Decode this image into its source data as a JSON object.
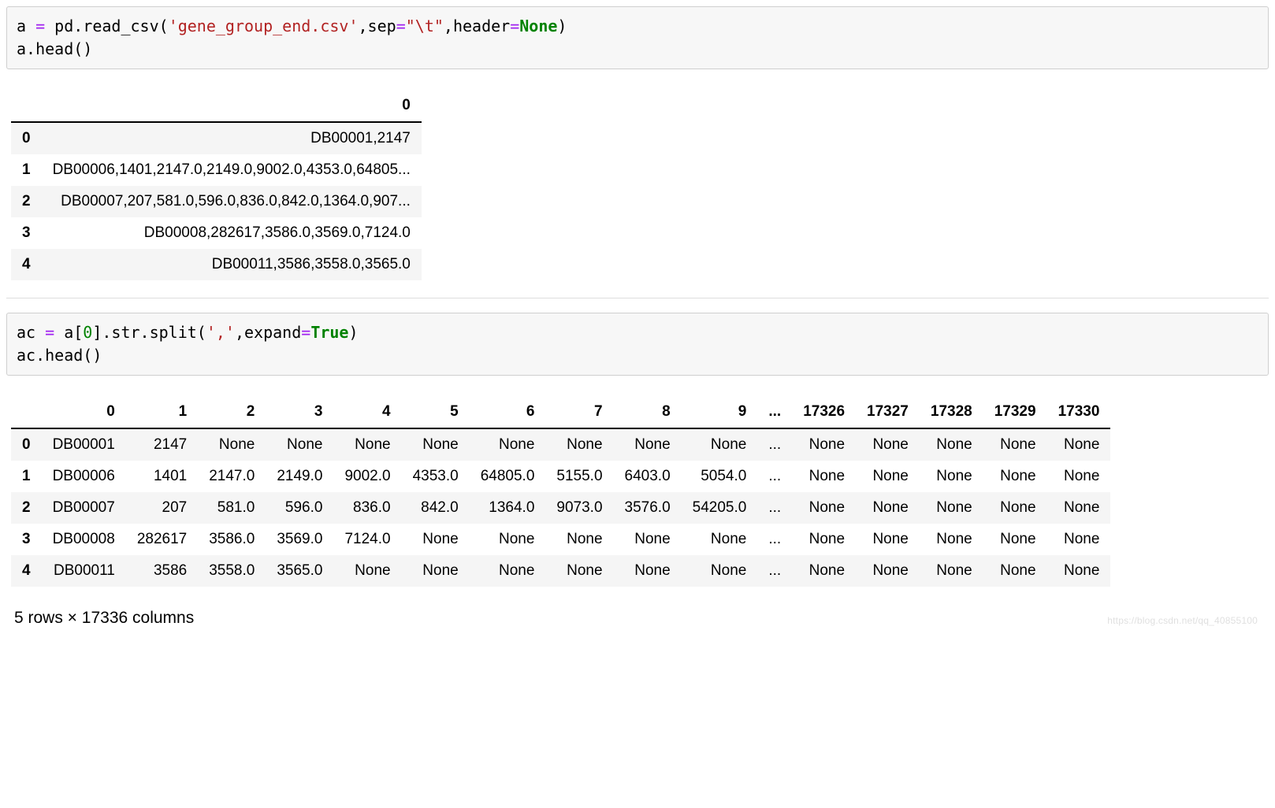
{
  "cell1": {
    "line1": {
      "prefix": "a ",
      "eq": "=",
      "fn": " pd.read_csv(",
      "arg_str": "'gene_group_end.csv'",
      "mid": ",sep",
      "eq2": "=",
      "sep_str": "\"\\t\"",
      "mid2": ",header",
      "eq3": "=",
      "none_kw": "None",
      "close": ")"
    },
    "line2": "a.head()"
  },
  "table1": {
    "columns": [
      "0"
    ],
    "rows": [
      {
        "idx": "0",
        "v": "DB00001,2147"
      },
      {
        "idx": "1",
        "v": "DB00006,1401,2147.0,2149.0,9002.0,4353.0,64805..."
      },
      {
        "idx": "2",
        "v": "DB00007,207,581.0,596.0,836.0,842.0,1364.0,907..."
      },
      {
        "idx": "3",
        "v": "DB00008,282617,3586.0,3569.0,7124.0"
      },
      {
        "idx": "4",
        "v": "DB00011,3586,3558.0,3565.0"
      }
    ]
  },
  "cell2": {
    "line1": {
      "prefix": "ac ",
      "eq": "=",
      "mid1": " a[",
      "zero": "0",
      "mid2": "].str.split(",
      "comma_str": "','",
      "mid3": ",expand",
      "eq2": "=",
      "true_kw": "True",
      "close": ")"
    },
    "line2": "ac.head()"
  },
  "table2": {
    "columns": [
      "0",
      "1",
      "2",
      "3",
      "4",
      "5",
      "6",
      "7",
      "8",
      "9",
      "...",
      "17326",
      "17327",
      "17328",
      "17329",
      "17330"
    ],
    "rows": [
      {
        "idx": "0",
        "cells": [
          "DB00001",
          "2147",
          "None",
          "None",
          "None",
          "None",
          "None",
          "None",
          "None",
          "None",
          "...",
          "None",
          "None",
          "None",
          "None",
          "None"
        ]
      },
      {
        "idx": "1",
        "cells": [
          "DB00006",
          "1401",
          "2147.0",
          "2149.0",
          "9002.0",
          "4353.0",
          "64805.0",
          "5155.0",
          "6403.0",
          "5054.0",
          "...",
          "None",
          "None",
          "None",
          "None",
          "None"
        ]
      },
      {
        "idx": "2",
        "cells": [
          "DB00007",
          "207",
          "581.0",
          "596.0",
          "836.0",
          "842.0",
          "1364.0",
          "9073.0",
          "3576.0",
          "54205.0",
          "...",
          "None",
          "None",
          "None",
          "None",
          "None"
        ]
      },
      {
        "idx": "3",
        "cells": [
          "DB00008",
          "282617",
          "3586.0",
          "3569.0",
          "7124.0",
          "None",
          "None",
          "None",
          "None",
          "None",
          "...",
          "None",
          "None",
          "None",
          "None",
          "None"
        ]
      },
      {
        "idx": "4",
        "cells": [
          "DB00011",
          "3586",
          "3558.0",
          "3565.0",
          "None",
          "None",
          "None",
          "None",
          "None",
          "None",
          "...",
          "None",
          "None",
          "None",
          "None",
          "None"
        ]
      }
    ]
  },
  "dim_note": "5 rows × 17336 columns",
  "watermark": "https://blog.csdn.net/qq_40855100"
}
